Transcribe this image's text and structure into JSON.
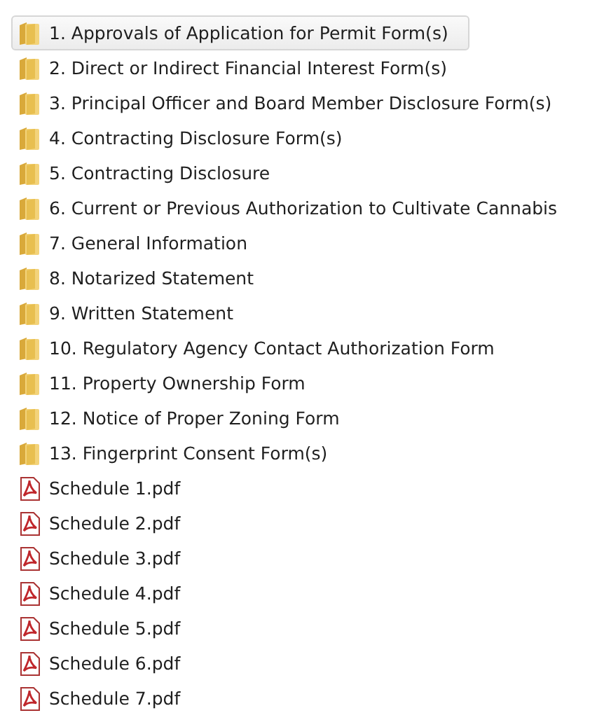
{
  "items": [
    {
      "kind": "folder",
      "name": "1. Approvals of Application for Permit Form(s)",
      "selected": true
    },
    {
      "kind": "folder",
      "name": "2. Direct or Indirect Financial Interest Form(s)",
      "selected": false
    },
    {
      "kind": "folder",
      "name": "3. Principal Officer and Board Member Disclosure Form(s)",
      "selected": false
    },
    {
      "kind": "folder",
      "name": "4. Contracting Disclosure Form(s)",
      "selected": false
    },
    {
      "kind": "folder",
      "name": "5. Contracting Disclosure",
      "selected": false
    },
    {
      "kind": "folder",
      "name": "6. Current or Previous Authorization to Cultivate Cannabis",
      "selected": false
    },
    {
      "kind": "folder",
      "name": "7. General Information",
      "selected": false
    },
    {
      "kind": "folder",
      "name": "8. Notarized Statement",
      "selected": false
    },
    {
      "kind": "folder",
      "name": "9. Written Statement",
      "selected": false
    },
    {
      "kind": "folder",
      "name": "10. Regulatory Agency Contact Authorization Form",
      "selected": false
    },
    {
      "kind": "folder",
      "name": "11. Property Ownership Form",
      "selected": false
    },
    {
      "kind": "folder",
      "name": "12. Notice of Proper Zoning Form",
      "selected": false
    },
    {
      "kind": "folder",
      "name": "13. Fingerprint Consent Form(s)",
      "selected": false
    },
    {
      "kind": "pdf",
      "name": "Schedule 1.pdf",
      "selected": false
    },
    {
      "kind": "pdf",
      "name": "Schedule 2.pdf",
      "selected": false
    },
    {
      "kind": "pdf",
      "name": "Schedule 3.pdf",
      "selected": false
    },
    {
      "kind": "pdf",
      "name": "Schedule 4.pdf",
      "selected": false
    },
    {
      "kind": "pdf",
      "name": "Schedule 5.pdf",
      "selected": false
    },
    {
      "kind": "pdf",
      "name": "Schedule 6.pdf",
      "selected": false
    },
    {
      "kind": "pdf",
      "name": "Schedule 7.pdf",
      "selected": false
    }
  ]
}
